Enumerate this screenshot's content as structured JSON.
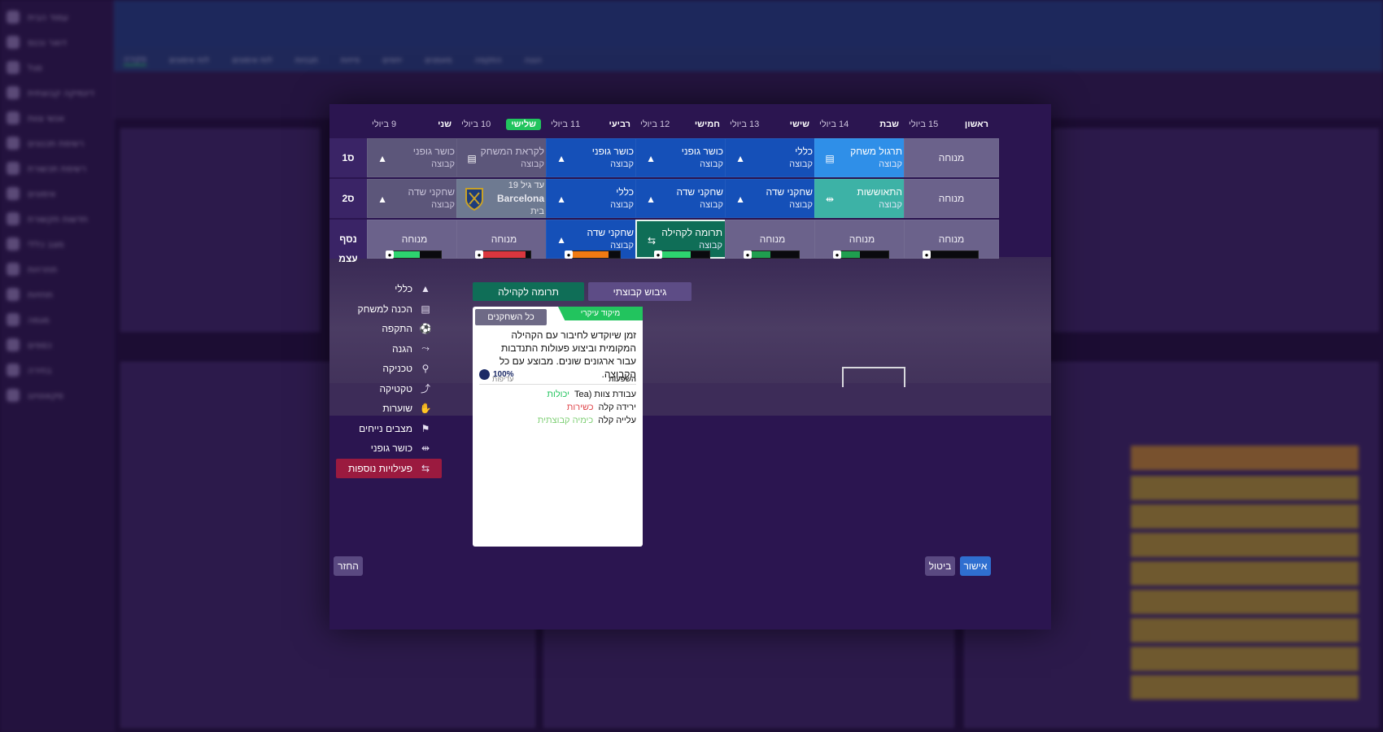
{
  "background": {
    "nav_items": [
      "עמוד הבית",
      "דואר נכנס",
      "סגל",
      "דינמיקה קבוצתית",
      "אנשי צוות",
      "רשימת תכנונים",
      "רשימת תכשורת",
      "אימונים",
      "חדשות תקשורת",
      "מצב כללי",
      "תחרויות",
      "תחזיות",
      "מגמה",
      "כספים",
      "בחירה",
      "סקאוטינג"
    ],
    "tabs": [
      "סקירה",
      "לוח אימונים",
      "לוח אימונים",
      "תבניות",
      "פיזיות",
      "יחסים",
      "מאמנים",
      "התקפה",
      "הגנה"
    ]
  },
  "schedule": {
    "days": [
      {
        "name": "שני",
        "date": "9 ביולי",
        "is_today": false
      },
      {
        "name": "שלישי",
        "date": "10 ביולי",
        "is_today": true
      },
      {
        "name": "רביעי",
        "date": "11 ביולי",
        "is_today": false
      },
      {
        "name": "חמישי",
        "date": "12 ביולי",
        "is_today": false
      },
      {
        "name": "שישי",
        "date": "13 ביולי",
        "is_today": false
      },
      {
        "name": "שבת",
        "date": "14 ביולי",
        "is_today": false
      },
      {
        "name": "ראשון",
        "date": "15 ביולי",
        "is_today": false
      }
    ],
    "row_labels": [
      "ס1",
      "ס2",
      "נסף",
      "עצמ"
    ],
    "rows": [
      [
        {
          "title": "כושר גופני",
          "sub": "קבוצה",
          "style": "faded",
          "icon": "cone-icon",
          "glyph": "▲"
        },
        {
          "title": "לקראת המשחק",
          "sub": "קבוצה",
          "style": "faded",
          "icon": "clipboard-icon",
          "glyph": "▤"
        },
        {
          "title": "כושר גופני",
          "sub": "קבוצה",
          "style": "blue",
          "icon": "cone-icon",
          "glyph": "▲"
        },
        {
          "title": "כושר גופני",
          "sub": "קבוצה",
          "style": "blue",
          "icon": "cone-icon",
          "glyph": "▲"
        },
        {
          "title": "כללי",
          "sub": "קבוצה",
          "style": "blue",
          "icon": "cone-icon",
          "glyph": "▲"
        },
        {
          "title": "תרגול משחק",
          "sub": "קבוצה",
          "style": "lightblue",
          "icon": "clipboard-icon",
          "glyph": "▤"
        },
        {
          "title": "מנוחה",
          "sub": "",
          "style": "rest",
          "icon": "",
          "glyph": ""
        }
      ],
      [
        {
          "title": "שחקני שדה",
          "sub": "קבוצה",
          "style": "faded",
          "icon": "cone-icon",
          "glyph": "▲"
        },
        {
          "title": "Barcelona",
          "sub": "בית",
          "top": "עד גיל 19",
          "style": "match",
          "icon": "club-crest-icon",
          "glyph": ""
        },
        {
          "title": "כללי",
          "sub": "קבוצה",
          "style": "blue",
          "icon": "cone-icon",
          "glyph": "▲"
        },
        {
          "title": "שחקני שדה",
          "sub": "קבוצה",
          "style": "blue",
          "icon": "cone-icon",
          "glyph": "▲"
        },
        {
          "title": "שחקני שדה",
          "sub": "קבוצה",
          "style": "blue",
          "icon": "cone-icon",
          "glyph": "▲"
        },
        {
          "title": "התאוששות",
          "sub": "קבוצה",
          "style": "teal",
          "icon": "dumbbell-icon",
          "glyph": "⇹"
        },
        {
          "title": "מנוחה",
          "sub": "",
          "style": "rest",
          "icon": "",
          "glyph": ""
        }
      ],
      [
        {
          "title": "מנוחה",
          "sub": "",
          "style": "rest",
          "icon": "",
          "glyph": ""
        },
        {
          "title": "מנוחה",
          "sub": "",
          "style": "rest",
          "icon": "",
          "glyph": ""
        },
        {
          "title": "שחקני שדה",
          "sub": "קבוצה",
          "style": "blue",
          "icon": "cone-icon",
          "glyph": "▲"
        },
        {
          "title": "תרומה לקהילה",
          "sub": "קבוצה",
          "style": "green",
          "icon": "community-icon",
          "glyph": "⇆"
        },
        {
          "title": "מנוחה",
          "sub": "",
          "style": "rest",
          "icon": "",
          "glyph": ""
        },
        {
          "title": "מנוחה",
          "sub": "",
          "style": "rest",
          "icon": "",
          "glyph": ""
        },
        {
          "title": "מנוחה",
          "sub": "",
          "style": "rest",
          "icon": "",
          "glyph": ""
        }
      ]
    ],
    "intensity": [
      {
        "level": 0.55,
        "color": "#2dd36f"
      },
      {
        "level": 0.9,
        "color": "#d9363e"
      },
      {
        "level": 0.75,
        "color": "#f07a12"
      },
      {
        "level": 0.6,
        "color": "#2dd36f"
      },
      {
        "level": 0.4,
        "color": "#1f9e4f"
      },
      {
        "level": 0.4,
        "color": "#1f9e4f"
      },
      {
        "level": 0.0,
        "color": "#1f9e4f"
      }
    ]
  },
  "categories": [
    {
      "label": "כללי",
      "icon": "cone-icon",
      "glyph": "▲",
      "active": false
    },
    {
      "label": "הכנה למשחק",
      "icon": "clipboard-icon",
      "glyph": "▤",
      "active": false
    },
    {
      "label": "התקפה",
      "icon": "kick-icon",
      "glyph": "⚽",
      "active": false
    },
    {
      "label": "הגנה",
      "icon": "tackle-icon",
      "glyph": "⤳",
      "active": false
    },
    {
      "label": "טכניקה",
      "icon": "dribble-icon",
      "glyph": "⚲",
      "active": false
    },
    {
      "label": "טקטיקה",
      "icon": "tactics-icon",
      "glyph": "⤴",
      "active": false
    },
    {
      "label": "שוערות",
      "icon": "goalkeeper-icon",
      "glyph": "✋",
      "active": false
    },
    {
      "label": "מצבים נייחים",
      "icon": "set-piece-icon",
      "glyph": "⚑",
      "active": false
    },
    {
      "label": "כושר גופני",
      "icon": "dumbbell-icon",
      "glyph": "⇹",
      "active": false
    },
    {
      "label": "פעילויות נוספות",
      "icon": "community-icon",
      "glyph": "⇆",
      "active": true
    }
  ],
  "tabs": {
    "community": "תרומה לקהילה",
    "team_bonding": "גיבוש קבוצתי"
  },
  "card": {
    "focus_label": "מיקוד עיקרי",
    "all_players_button": "כל השחקנים",
    "description": "זמן שיוקדש לחיבור עם הקהילה המקומית וביצוע פעולות התנדבות עבור ארגונים שונים. מבוצע עם כל הקבוצה.",
    "effects_header": "השפעות",
    "priority_header": "עדיפות",
    "percent": "100%",
    "effects": [
      {
        "label": "עבודת צוות (Tea",
        "value": "יכולות",
        "color": "#22c45e"
      },
      {
        "label": "ירידה קלה",
        "value": "כשירות",
        "color": "#e0474c"
      },
      {
        "label": "עלייה קלה",
        "value": "כימיה קבוצתית",
        "color": "#7fcf75"
      }
    ]
  },
  "buttons": {
    "back": "החזר",
    "cancel": "ביטול",
    "confirm": "אישור"
  }
}
